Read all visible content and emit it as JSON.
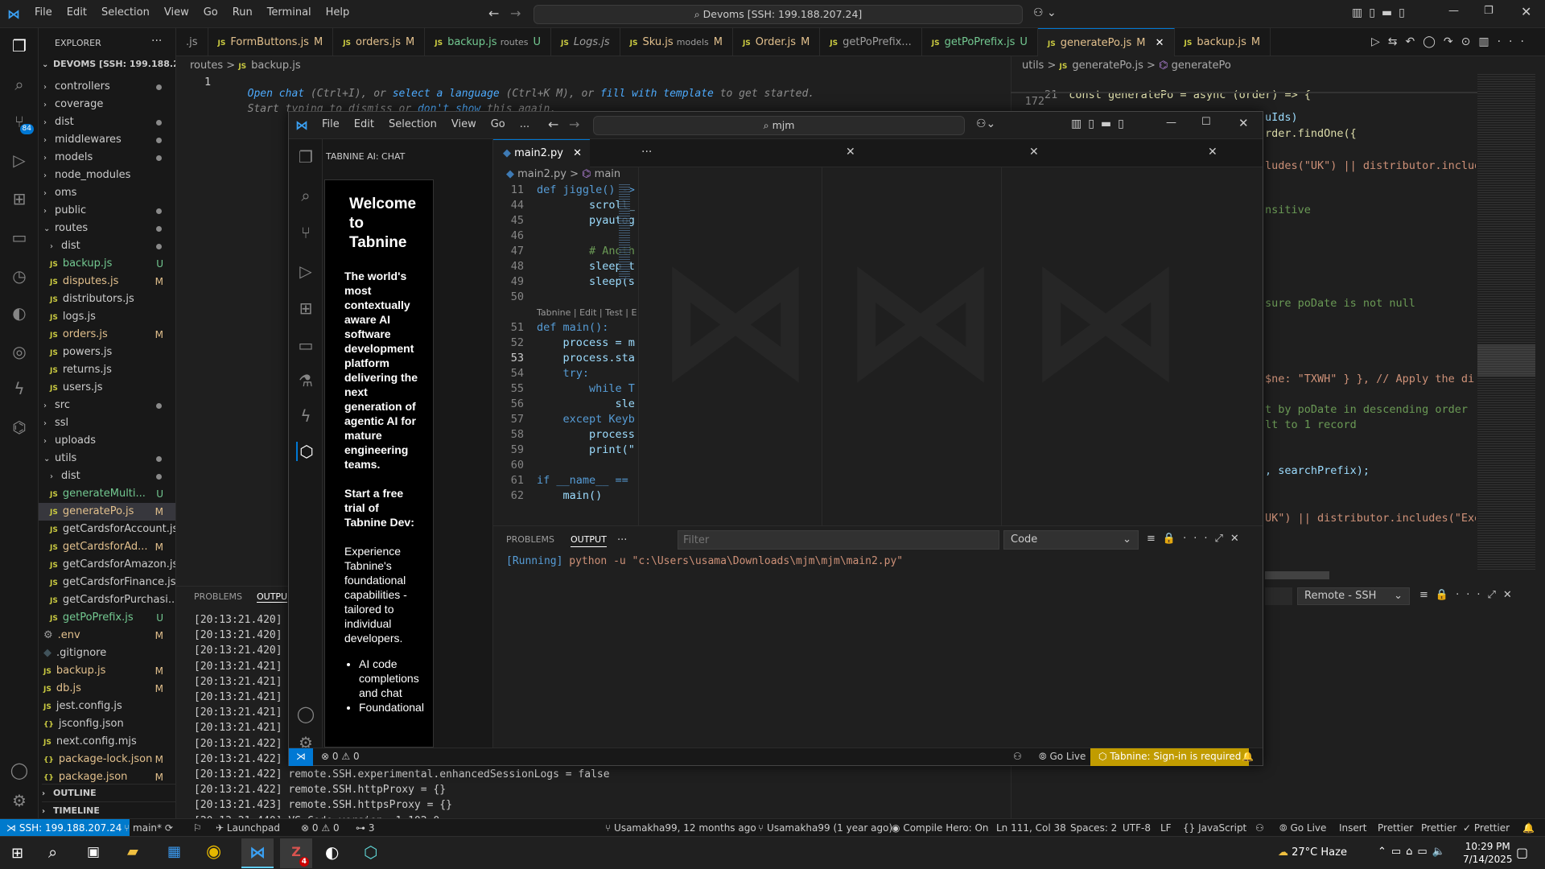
{
  "titlebar": {
    "menu": [
      "File",
      "Edit",
      "Selection",
      "View",
      "Go",
      "Run",
      "Terminal",
      "Help"
    ],
    "command_center": "Devoms [SSH: 199.188.207.24]"
  },
  "explorer": {
    "title": "EXPLORER",
    "root": "DEVOMS [SSH: 199.188.20...",
    "items": [
      {
        "label": "controllers",
        "type": "folder",
        "indent": 1,
        "status": "dot"
      },
      {
        "label": "coverage",
        "type": "folder",
        "indent": 1,
        "status": ""
      },
      {
        "label": "dist",
        "type": "folder",
        "indent": 1,
        "status": "dot"
      },
      {
        "label": "middlewares",
        "type": "folder",
        "indent": 1,
        "status": "dot"
      },
      {
        "label": "models",
        "type": "folder",
        "indent": 1,
        "status": "dot"
      },
      {
        "label": "node_modules",
        "type": "folder",
        "indent": 1,
        "status": ""
      },
      {
        "label": "oms",
        "type": "folder",
        "indent": 1,
        "status": ""
      },
      {
        "label": "public",
        "type": "folder",
        "indent": 1,
        "status": "dot"
      },
      {
        "label": "routes",
        "type": "folder-open",
        "indent": 1,
        "status": "dot"
      },
      {
        "label": "dist",
        "type": "folder",
        "indent": 2,
        "status": "dot"
      },
      {
        "label": "backup.js",
        "type": "js",
        "indent": 2,
        "status": "U",
        "color": "#73c991"
      },
      {
        "label": "disputes.js",
        "type": "js",
        "indent": 2,
        "status": "M",
        "color": "#e2c08d"
      },
      {
        "label": "distributors.js",
        "type": "js",
        "indent": 2,
        "status": ""
      },
      {
        "label": "logs.js",
        "type": "js",
        "indent": 2,
        "status": ""
      },
      {
        "label": "orders.js",
        "type": "js",
        "indent": 2,
        "status": "M",
        "color": "#e2c08d"
      },
      {
        "label": "powers.js",
        "type": "js",
        "indent": 2,
        "status": ""
      },
      {
        "label": "returns.js",
        "type": "js",
        "indent": 2,
        "status": ""
      },
      {
        "label": "users.js",
        "type": "js",
        "indent": 2,
        "status": ""
      },
      {
        "label": "src",
        "type": "folder",
        "indent": 1,
        "status": "dot"
      },
      {
        "label": "ssl",
        "type": "folder",
        "indent": 1,
        "status": ""
      },
      {
        "label": "uploads",
        "type": "folder",
        "indent": 1,
        "status": ""
      },
      {
        "label": "utils",
        "type": "folder-open",
        "indent": 1,
        "status": "dot"
      },
      {
        "label": "dist",
        "type": "folder",
        "indent": 2,
        "status": "dot"
      },
      {
        "label": "generateMulti...",
        "type": "js",
        "indent": 2,
        "status": "U",
        "color": "#73c991"
      },
      {
        "label": "generatePo.js",
        "type": "js",
        "indent": 2,
        "status": "M",
        "color": "#e2c08d",
        "selected": true
      },
      {
        "label": "getCardsforAccount.js",
        "type": "js",
        "indent": 2,
        "status": ""
      },
      {
        "label": "getCardsforAd...",
        "type": "js",
        "indent": 2,
        "status": "M",
        "color": "#e2c08d"
      },
      {
        "label": "getCardsforAmazon.js",
        "type": "js",
        "indent": 2,
        "status": ""
      },
      {
        "label": "getCardsforFinance.js",
        "type": "js",
        "indent": 2,
        "status": ""
      },
      {
        "label": "getCardsforPurchasi...",
        "type": "js",
        "indent": 2,
        "status": ""
      },
      {
        "label": "getPoPrefix.js",
        "type": "js",
        "indent": 2,
        "status": "U",
        "color": "#73c991"
      },
      {
        "label": ".env",
        "type": "gear",
        "indent": 1,
        "status": "M",
        "color": "#e2c08d"
      },
      {
        "label": ".gitignore",
        "type": "diamond",
        "indent": 1,
        "status": ""
      },
      {
        "label": "backup.js",
        "type": "js",
        "indent": 1,
        "status": "M",
        "color": "#e2c08d"
      },
      {
        "label": "db.js",
        "type": "js",
        "indent": 1,
        "status": "M",
        "color": "#e2c08d"
      },
      {
        "label": "jest.config.js",
        "type": "js",
        "indent": 1,
        "status": ""
      },
      {
        "label": "jsconfig.json",
        "type": "json",
        "indent": 1,
        "status": ""
      },
      {
        "label": "next.config.mjs",
        "type": "js",
        "indent": 1,
        "status": ""
      },
      {
        "label": "package-lock.json",
        "type": "json",
        "indent": 1,
        "status": "M",
        "color": "#e2c08d"
      },
      {
        "label": "package.json",
        "type": "json",
        "indent": 1,
        "status": "M",
        "color": "#e2c08d"
      }
    ],
    "outline": "OUTLINE",
    "timeline": "TIMELINE"
  },
  "tabs": [
    {
      "label": ".js",
      "mod": "",
      "cls": ""
    },
    {
      "label": "FormButtons.js",
      "mod": "M",
      "cls": "mod"
    },
    {
      "label": "orders.js",
      "mod": "M",
      "cls": "mod"
    },
    {
      "label": "backup.js",
      "sub": "routes",
      "mod": "U",
      "cls": "unt"
    },
    {
      "label": "Logs.js",
      "mod": "",
      "cls": "",
      "dim": true
    },
    {
      "label": "Sku.js",
      "sub": "models",
      "mod": "M",
      "cls": "mod"
    },
    {
      "label": "Order.js",
      "mod": "M",
      "cls": "mod"
    },
    {
      "label": "getPoPrefix",
      "mod": "...",
      "cls": ""
    },
    {
      "label": "getPoPrefix.js",
      "mod": "U",
      "cls": "unt"
    },
    {
      "label": "generatePo.js",
      "mod": "M",
      "cls": "mod",
      "active": true
    },
    {
      "label": "backup.js",
      "mod": "M",
      "cls": "mod"
    }
  ],
  "left_editor": {
    "breadcrumb": [
      "routes",
      ">",
      "backup.js"
    ],
    "line_no": "1",
    "hint1_parts": [
      "Open chat",
      " (Ctrl+I), or ",
      "select a language",
      " (Ctrl+K M), or ",
      "fill with template",
      " to get started."
    ],
    "hint2_parts": [
      "Start typing to dismiss or ",
      "don't show",
      " this again."
    ]
  },
  "right_editor": {
    "breadcrumb": [
      "utils",
      ">",
      "generatePo.js",
      ">",
      "generatePo"
    ],
    "lines": [
      {
        "n": "21",
        "text": "const generatePo = async (order) => {"
      },
      {
        "n": "172",
        "text": ""
      }
    ],
    "fragments": [
      "uIds)",
      "rder.findOne({",
      "ludes(\"UK\") || distributor.includ",
      "nsitive",
      "sure poDate is not null",
      "$ne: \"TXWH\" } }, // Apply the di",
      "t by poDate in descending order",
      "lt to 1 record",
      ", searchPrefix);",
      "UK\") || distributor.includes(\"Exe"
    ],
    "panel_dropdown": "Remote - SSH"
  },
  "left_panel": {
    "tabs": [
      "PROBLEMS",
      "OUTPU"
    ],
    "log_lines": [
      "[20:13:21.420]",
      "[20:13:21.420]",
      "[20:13:21.420]",
      "[20:13:21.421]",
      "[20:13:21.421]",
      "[20:13:21.421]",
      "[20:13:21.421]",
      "[20:13:21.421]",
      "[20:13:21.422]",
      "[20:13:21.422]",
      "[20:13:21.422] remote.SSH.experimental.enhancedSessionLogs = false",
      "[20:13:21.422] remote.SSH.httpProxy = {}",
      "[20:13:21.423] remote.SSH.httpsProxy = {}",
      "[20:13:21.440] VS Code version: 1.102.0"
    ]
  },
  "floating": {
    "menu": [
      "File",
      "Edit",
      "Selection",
      "View",
      "Go",
      "..."
    ],
    "search": "mjm",
    "chat_title": "TABNINE AI: CHAT",
    "welcome": "Welcome to Tabnine",
    "tagline": "The world's most contextually aware AI software development platform delivering the next generation of agentic AI for mature engineering teams.",
    "trial": "Start a free trial of Tabnine Dev:",
    "experience": "Experience Tabnine's foundational capabilities - tailored to individual developers.",
    "bullets": [
      "AI code completions and chat",
      "Foundational"
    ],
    "tab": "main2.py",
    "breadcrumb": [
      "main2.py",
      ">",
      "main"
    ],
    "codelens": "Tabnine | Edit | Test | E",
    "code": [
      {
        "n": "11",
        "t": "def jiggle() ->"
      },
      {
        "n": "44",
        "t": "        scroll_"
      },
      {
        "n": "45",
        "t": "        pyautog"
      },
      {
        "n": "46",
        "t": ""
      },
      {
        "n": "47",
        "t": "        # Anoth"
      },
      {
        "n": "48",
        "t": "        sleep_t"
      },
      {
        "n": "49",
        "t": "        sleep(s"
      },
      {
        "n": "50",
        "t": ""
      },
      {
        "n": "51",
        "t": "def main():"
      },
      {
        "n": "52",
        "t": "    process = m"
      },
      {
        "n": "53",
        "t": "    process.sta"
      },
      {
        "n": "54",
        "t": "    try:"
      },
      {
        "n": "55",
        "t": "        while T"
      },
      {
        "n": "56",
        "t": "            sle"
      },
      {
        "n": "57",
        "t": "    except Keyb"
      },
      {
        "n": "58",
        "t": "        process"
      },
      {
        "n": "59",
        "t": "        print(\""
      },
      {
        "n": "60",
        "t": ""
      },
      {
        "n": "61",
        "t": "if __name__ =="
      },
      {
        "n": "62",
        "t": "    main()"
      }
    ],
    "panel_tabs": [
      "PROBLEMS",
      "OUTPUT",
      "..."
    ],
    "filter_placeholder": "Filter",
    "output_channel": "Code",
    "output_running": "[Running]",
    "output_line": " python -u \"c:\\Users\\usama\\Downloads\\mjm\\mjm\\main2.py\"",
    "status": {
      "errors": "0",
      "warnings": "0",
      "golive": "Go Live",
      "tabnine": "Tabnine: Sign-in is required"
    }
  },
  "statusbar": {
    "remote": "SSH: 199.188.207.24",
    "branch": "main*",
    "launchpad": "Launchpad",
    "errors": "0",
    "warnings": "0",
    "ports": "3",
    "blame1": "Usamakha99, 12 months ago",
    "blame2": "Usamakha99 (1 year ago)",
    "compile": "Compile Hero: On",
    "position": "Ln 111, Col 38",
    "spaces": "Spaces: 2",
    "encoding": "UTF-8",
    "eol": "LF",
    "language": "JavaScript",
    "golive": "Go Live",
    "insert": "Insert",
    "prettier1": "Prettier",
    "prettier2": "Prettier",
    "prettier3": "Prettier"
  },
  "taskbar": {
    "weather": "27°C  Haze",
    "time": "10:29 PM",
    "date": "7/14/2025",
    "zoom_badge": "4"
  },
  "colors": {
    "accent": "#0078d4",
    "tabnine_badge": "#c19c00",
    "remote_bg": "#007acc"
  }
}
